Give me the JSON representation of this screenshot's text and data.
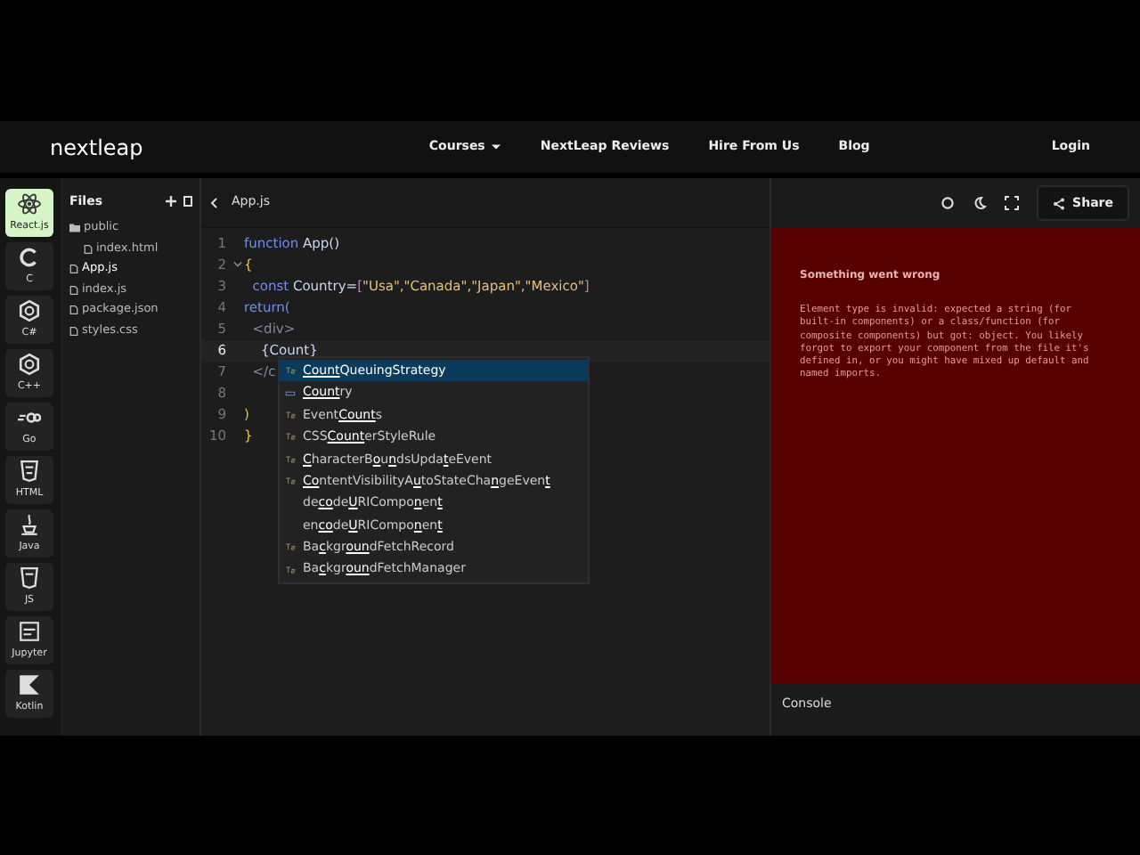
{
  "navbar": {
    "logo": "nextleap",
    "links": [
      {
        "label": "Courses",
        "dropdown": true
      },
      {
        "label": "NextLeap Reviews",
        "dropdown": false
      },
      {
        "label": "Hire From Us",
        "dropdown": false
      },
      {
        "label": "Blog",
        "dropdown": false
      }
    ],
    "login": "Login"
  },
  "languages": [
    {
      "label": "React.js",
      "selected": true
    },
    {
      "label": "C",
      "selected": false
    },
    {
      "label": "C#",
      "selected": false
    },
    {
      "label": "C++",
      "selected": false
    },
    {
      "label": "Go",
      "selected": false
    },
    {
      "label": "HTML",
      "selected": false
    },
    {
      "label": "Java",
      "selected": false
    },
    {
      "label": "JS",
      "selected": false
    },
    {
      "label": "Jupyter",
      "selected": false
    },
    {
      "label": "Kotlin",
      "selected": false
    }
  ],
  "files": {
    "title": "Files",
    "items": [
      {
        "name": "public",
        "selected": false,
        "children": [
          {
            "name": "index.html",
            "selected": false
          }
        ]
      },
      {
        "name": "App.js",
        "selected": true
      },
      {
        "name": "index.js",
        "selected": false
      },
      {
        "name": "package.json",
        "selected": false
      },
      {
        "name": "styles.css",
        "selected": false
      }
    ]
  },
  "editor": {
    "tab": "App.js",
    "lines": [
      {
        "number": "1",
        "current": false,
        "fold": false,
        "tokens": [
          {
            "text": "function",
            "kind": "keyword"
          },
          {
            "text": " App()",
            "kind": "ident"
          }
        ]
      },
      {
        "number": "2",
        "current": false,
        "fold": true,
        "tokens": [
          {
            "text": "{",
            "kind": "brace"
          }
        ]
      },
      {
        "number": "3",
        "current": false,
        "fold": false,
        "tokens": [
          {
            "text": "  const",
            "kind": "keyword"
          },
          {
            "text": " Country=",
            "kind": "ident"
          },
          {
            "text": "[",
            "kind": "punct"
          },
          {
            "text": "\"Usa\",\"Canada\",\"Japan\",\"Mexico\"",
            "kind": "string"
          },
          {
            "text": "]",
            "kind": "punct"
          }
        ]
      },
      {
        "number": "4",
        "current": false,
        "fold": false,
        "tokens": [
          {
            "text": "return(",
            "kind": "keyword"
          }
        ]
      },
      {
        "number": "5",
        "current": false,
        "fold": false,
        "tokens": [
          {
            "text": "  <div>",
            "kind": "tag"
          }
        ]
      },
      {
        "number": "6",
        "current": true,
        "fold": false,
        "tokens": [
          {
            "text": "    {Count}",
            "kind": "ident"
          }
        ]
      },
      {
        "number": "7",
        "current": false,
        "fold": false,
        "tokens": [
          {
            "text": "  </c",
            "kind": "tag"
          }
        ]
      },
      {
        "number": "8",
        "current": false,
        "fold": false
      },
      {
        "number": "9",
        "current": false,
        "fold": false,
        "tokens": [
          {
            "text": ")",
            "kind": "brace"
          }
        ]
      },
      {
        "number": "10",
        "current": false,
        "fold": false,
        "tokens": [
          {
            "text": "}",
            "kind": "brace"
          }
        ]
      }
    ],
    "suggestions": [
      {
        "kind": "class",
        "selected": true,
        "parts": [
          {
            "text": "Count",
            "match": true
          },
          {
            "text": "QueuingStrategy",
            "match": false
          }
        ]
      },
      {
        "kind": "variable",
        "selected": false,
        "parts": [
          {
            "text": "Count",
            "match": true
          },
          {
            "text": "ry",
            "match": false
          }
        ]
      },
      {
        "kind": "class",
        "selected": false,
        "parts": [
          {
            "text": "Event",
            "match": false
          },
          {
            "text": "Count",
            "match": true
          },
          {
            "text": "s",
            "match": false
          }
        ]
      },
      {
        "kind": "class",
        "selected": false,
        "parts": [
          {
            "text": "CSS",
            "match": false
          },
          {
            "text": "Count",
            "match": true
          },
          {
            "text": "erStyleRule",
            "match": false
          }
        ]
      },
      {
        "kind": "class",
        "selected": false,
        "parts": [
          {
            "text": "C",
            "match": true
          },
          {
            "text": "haracterB",
            "match": false
          },
          {
            "text": "o",
            "match": true
          },
          {
            "text": "u",
            "match": false
          },
          {
            "text": "n",
            "match": true
          },
          {
            "text": "dsUpda",
            "match": false
          },
          {
            "text": "t",
            "match": true
          },
          {
            "text": "eEvent",
            "match": false
          }
        ]
      },
      {
        "kind": "class",
        "selected": false,
        "parts": [
          {
            "text": "Co",
            "match": true
          },
          {
            "text": "ntentVisibilityA",
            "match": false
          },
          {
            "text": "u",
            "match": true
          },
          {
            "text": "toStateCha",
            "match": false
          },
          {
            "text": "n",
            "match": true
          },
          {
            "text": "geEven",
            "match": false
          },
          {
            "text": "t",
            "match": true
          }
        ]
      },
      {
        "kind": "function",
        "selected": false,
        "parts": [
          {
            "text": "de",
            "match": false
          },
          {
            "text": "co",
            "match": true
          },
          {
            "text": "de",
            "match": false
          },
          {
            "text": "U",
            "match": true
          },
          {
            "text": "RICompo",
            "match": false
          },
          {
            "text": "n",
            "match": true
          },
          {
            "text": "en",
            "match": false
          },
          {
            "text": "t",
            "match": true
          }
        ]
      },
      {
        "kind": "function",
        "selected": false,
        "parts": [
          {
            "text": "en",
            "match": false
          },
          {
            "text": "co",
            "match": true
          },
          {
            "text": "de",
            "match": false
          },
          {
            "text": "U",
            "match": true
          },
          {
            "text": "RICompo",
            "match": false
          },
          {
            "text": "n",
            "match": true
          },
          {
            "text": "en",
            "match": false
          },
          {
            "text": "t",
            "match": true
          }
        ]
      },
      {
        "kind": "class",
        "selected": false,
        "parts": [
          {
            "text": "Ba",
            "match": false
          },
          {
            "text": "c",
            "match": true
          },
          {
            "text": "kgr",
            "match": false
          },
          {
            "text": "oun",
            "match": true
          },
          {
            "text": "dFetchRecord",
            "match": false
          }
        ]
      },
      {
        "kind": "class",
        "selected": false,
        "parts": [
          {
            "text": "Ba",
            "match": false
          },
          {
            "text": "c",
            "match": true
          },
          {
            "text": "kgr",
            "match": false
          },
          {
            "text": "oun",
            "match": true
          },
          {
            "text": "dFetchManager",
            "match": false
          }
        ]
      }
    ]
  },
  "preview": {
    "share": "Share",
    "error_title": "Something went wrong",
    "error_message": "Element type is invalid: expected a string (for built-in components) or a class/function (for composite components) but got: object. You likely forgot to export your component from the file it's defined in, or you might have mixed up default and named imports.",
    "console": "Console"
  }
}
